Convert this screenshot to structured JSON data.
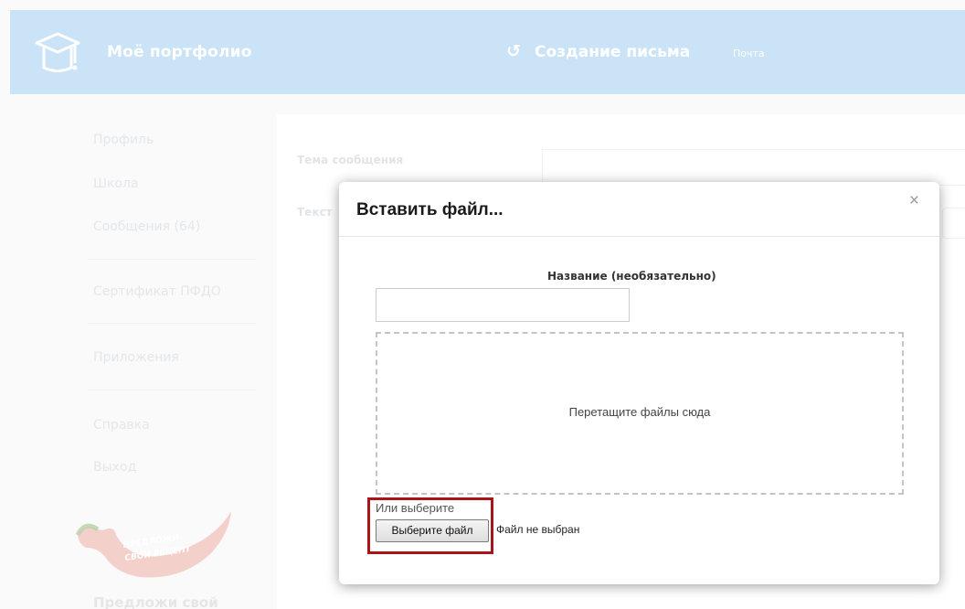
{
  "header": {
    "brand": "Моё портфолио",
    "refresh_icon": "refresh-icon",
    "page_title": "Создание письма",
    "crumb": "Почта",
    "background": "#cbe3f7"
  },
  "sidebar": {
    "items": [
      {
        "label": "Профиль"
      },
      {
        "label": "Школа"
      },
      {
        "label": "Сообщения (64)"
      },
      {
        "label": "Сертификат ПФДО"
      },
      {
        "label": "Приложения"
      },
      {
        "label": "Справка"
      },
      {
        "label": "Выход"
      }
    ],
    "promo": {
      "badge_line1": "ПРЕДЛОЖИ",
      "badge_line2": "СВОЙ РЕЦЕПТ",
      "text": "Предложи свой"
    }
  },
  "form": {
    "subject_label": "Тема сообщения",
    "body_label": "Текст"
  },
  "modal": {
    "title": "Вставить файл...",
    "close_label": "×",
    "name_label": "Название (необязательно)",
    "name_value": "",
    "dropzone_text": "Перетащите файлы сюда",
    "or_text": "Или выберите",
    "choose_button": "Выберите файл",
    "no_file_text": "Файл не выбран"
  },
  "colors": {
    "highlight": "#a8161c",
    "pepper": "#d33a2c"
  }
}
